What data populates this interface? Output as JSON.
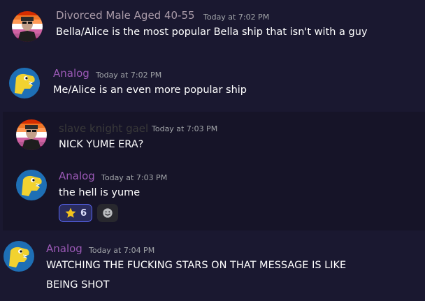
{
  "messages": [
    {
      "username": "Divorced Male Aged 40-55",
      "timestamp": "Today at 7:02 PM",
      "text": "Bella/Alice is the most popular Bella ship that isn't with a guy",
      "name_color": "#a99aa8"
    },
    {
      "username": "Analog",
      "timestamp": "Today at 7:02 PM",
      "text": "Me/Alice is an even more popular ship",
      "name_color": "#9b59b6"
    },
    {
      "username": "slave knight gael",
      "timestamp": "Today at 7:03 PM",
      "text": "NICK YUME ERA?",
      "name_color": "#3a3a3a"
    },
    {
      "username": "Analog",
      "timestamp": "Today at 7:03 PM",
      "text": "the hell is yume",
      "name_color": "#9b59b6",
      "reactions": [
        {
          "emoji": "star",
          "count": "6"
        }
      ],
      "add_reaction_icon": "smiley-add-reaction-icon"
    },
    {
      "username": "Analog",
      "timestamp": "Today at 7:04 PM",
      "text_line1": "WATCHING THE FUCKING STARS ON THAT MESSAGE IS LIKE",
      "text_line2": "BEING SHOT",
      "name_color": "#9b59b6"
    }
  ],
  "colors": {
    "background": "#1a1830",
    "nested_background": "#161428",
    "reaction_active_bg": "#2a2c5e",
    "reaction_active_border": "#5865f2",
    "text": "#ffffff",
    "timestamp": "#a3a6aa"
  }
}
